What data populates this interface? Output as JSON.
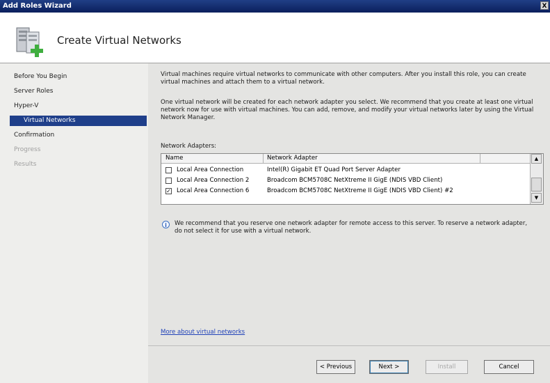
{
  "window": {
    "title": "Add Roles Wizard",
    "close_glyph": "X"
  },
  "header": {
    "page_title": "Create Virtual Networks",
    "icon": "server-role-icon"
  },
  "sidebar": {
    "items": [
      {
        "label": "Before You Begin",
        "state": "normal"
      },
      {
        "label": "Server Roles",
        "state": "normal"
      },
      {
        "label": "Hyper-V",
        "state": "normal"
      },
      {
        "label": "Virtual Networks",
        "state": "selected"
      },
      {
        "label": "Confirmation",
        "state": "normal"
      },
      {
        "label": "Progress",
        "state": "disabled"
      },
      {
        "label": "Results",
        "state": "disabled"
      }
    ]
  },
  "main": {
    "intro": "Virtual machines require virtual networks to communicate with other computers. After you install this role, you can create virtual machines and attach them to a virtual network.",
    "detail": "One virtual network will be created for each network adapter you select. We recommend that you create at least one virtual network now for use with virtual machines. You can add, remove, and modify your virtual networks later by using the Virtual Network Manager.",
    "adapters_label": "Network Adapters:",
    "columns": {
      "name": "Name",
      "adapter": "Network Adapter"
    },
    "rows": [
      {
        "name": "Local Area Connection",
        "adapter": "Intel(R) Gigabit ET Quad Port Server Adapter",
        "checked": false
      },
      {
        "name": "Local Area Connection 2",
        "adapter": "Broadcom BCM5708C NetXtreme II GigE (NDIS VBD Client)",
        "checked": false
      },
      {
        "name": "Local Area Connection 6",
        "adapter": "Broadcom BCM5708C NetXtreme II GigE (NDIS VBD Client) #2",
        "checked": true
      }
    ],
    "info": "We recommend that you reserve one network adapter for remote access to this server. To reserve a network adapter, do not select it for use with a virtual network.",
    "more_link": "More about virtual networks"
  },
  "buttons": {
    "previous": "< Previous",
    "next": "Next >",
    "install": "Install",
    "cancel": "Cancel"
  },
  "colors": {
    "titlebar": "#0b1f5c",
    "selected_nav": "#1f3f8a",
    "link": "#2042b8"
  }
}
